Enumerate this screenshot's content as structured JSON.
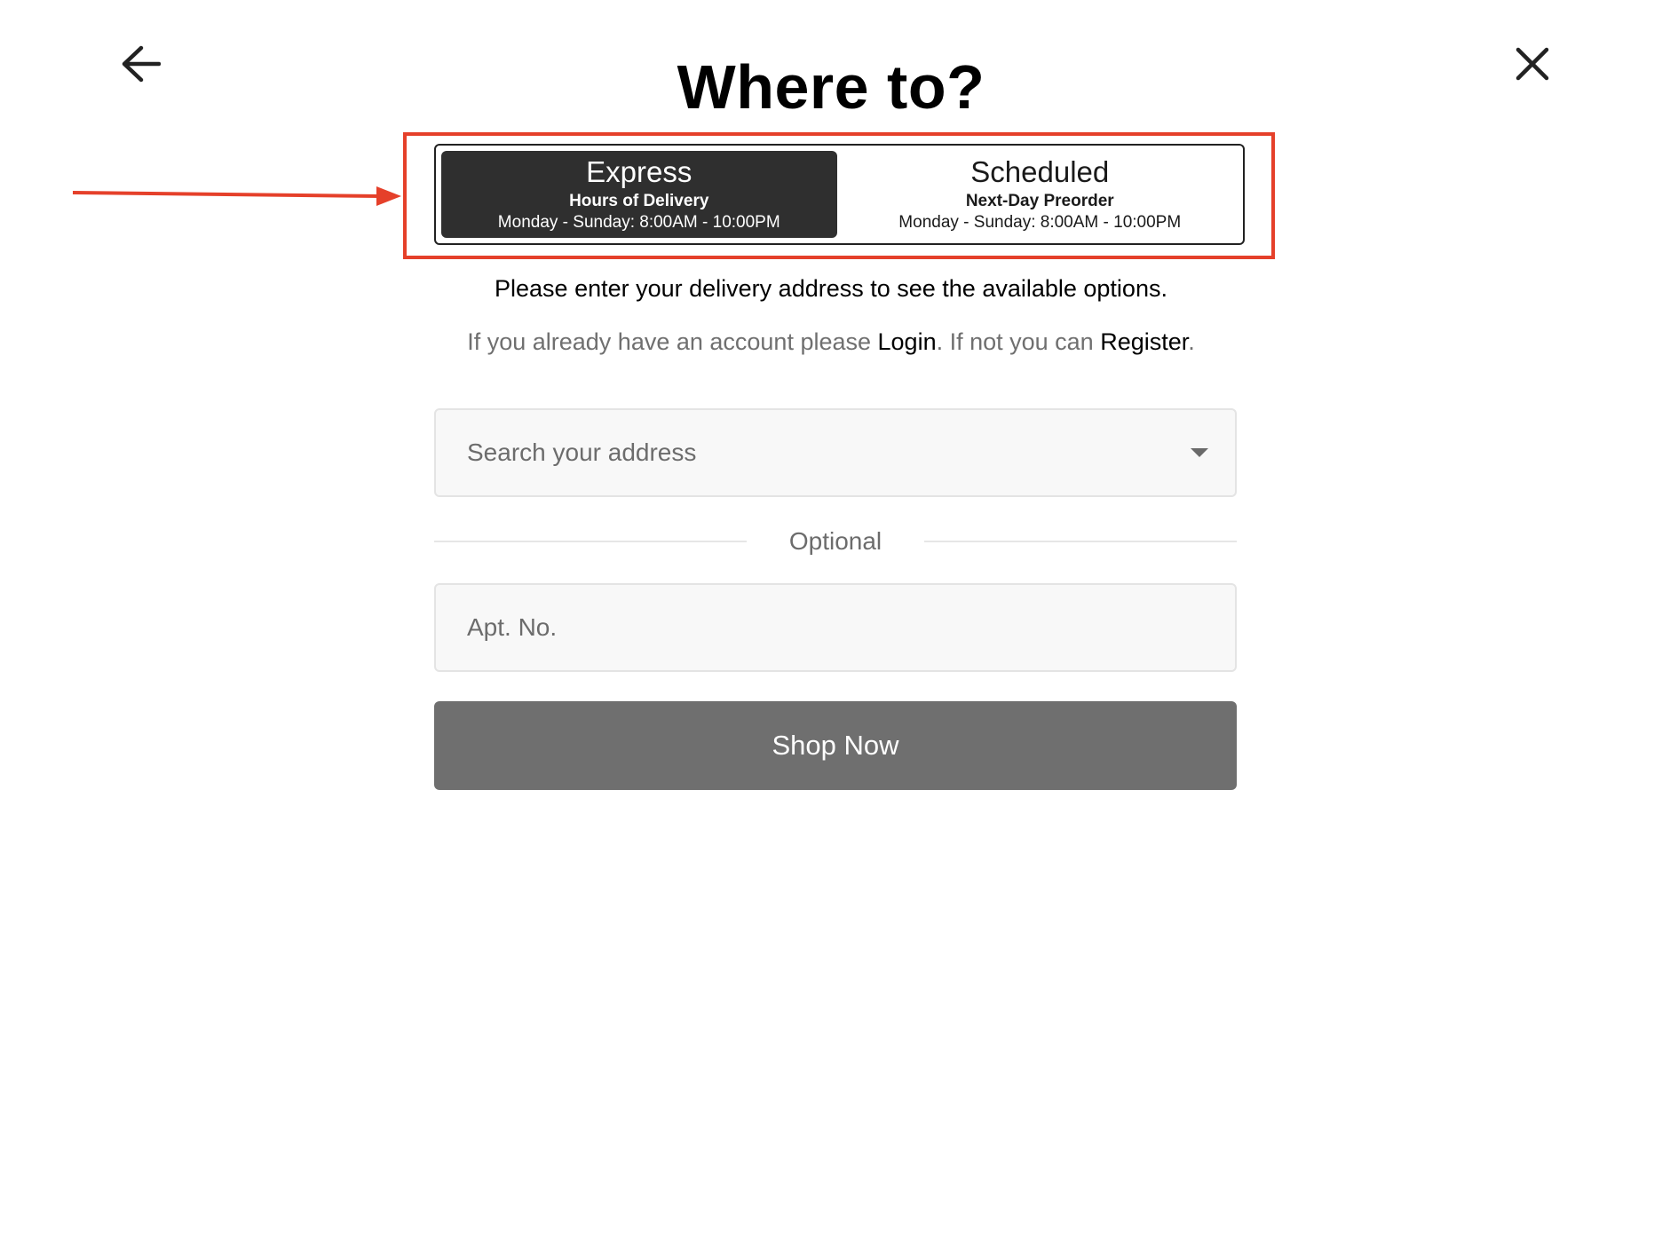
{
  "header": {
    "back_icon": "arrow-left-icon",
    "close_icon": "close-icon",
    "title": "Where to?"
  },
  "delivery_modes": {
    "selected": "Express",
    "options": [
      {
        "name": "Express",
        "subtitle": "Hours of Delivery",
        "hours": "Monday - Sunday: 8:00AM - 10:00PM"
      },
      {
        "name": "Scheduled",
        "subtitle": "Next-Day Preorder",
        "hours": "Monday - Sunday: 8:00AM - 10:00PM"
      }
    ]
  },
  "instruction": "Please enter your delivery address to see the available options.",
  "account": {
    "prefix": "If you already have an account please ",
    "login": "Login",
    "middle": ". If not you can ",
    "register": "Register",
    "suffix": "."
  },
  "address": {
    "placeholder": "Search your address",
    "value": "",
    "dropdown_icon": "caret-down-icon"
  },
  "divider_label": "Optional",
  "apartment": {
    "placeholder": "Apt. No.",
    "value": ""
  },
  "submit_label": "Shop Now",
  "colors": {
    "annotation": "#e5402a",
    "active_tab": "#2f2f2f",
    "button": "#6f6f6f"
  }
}
